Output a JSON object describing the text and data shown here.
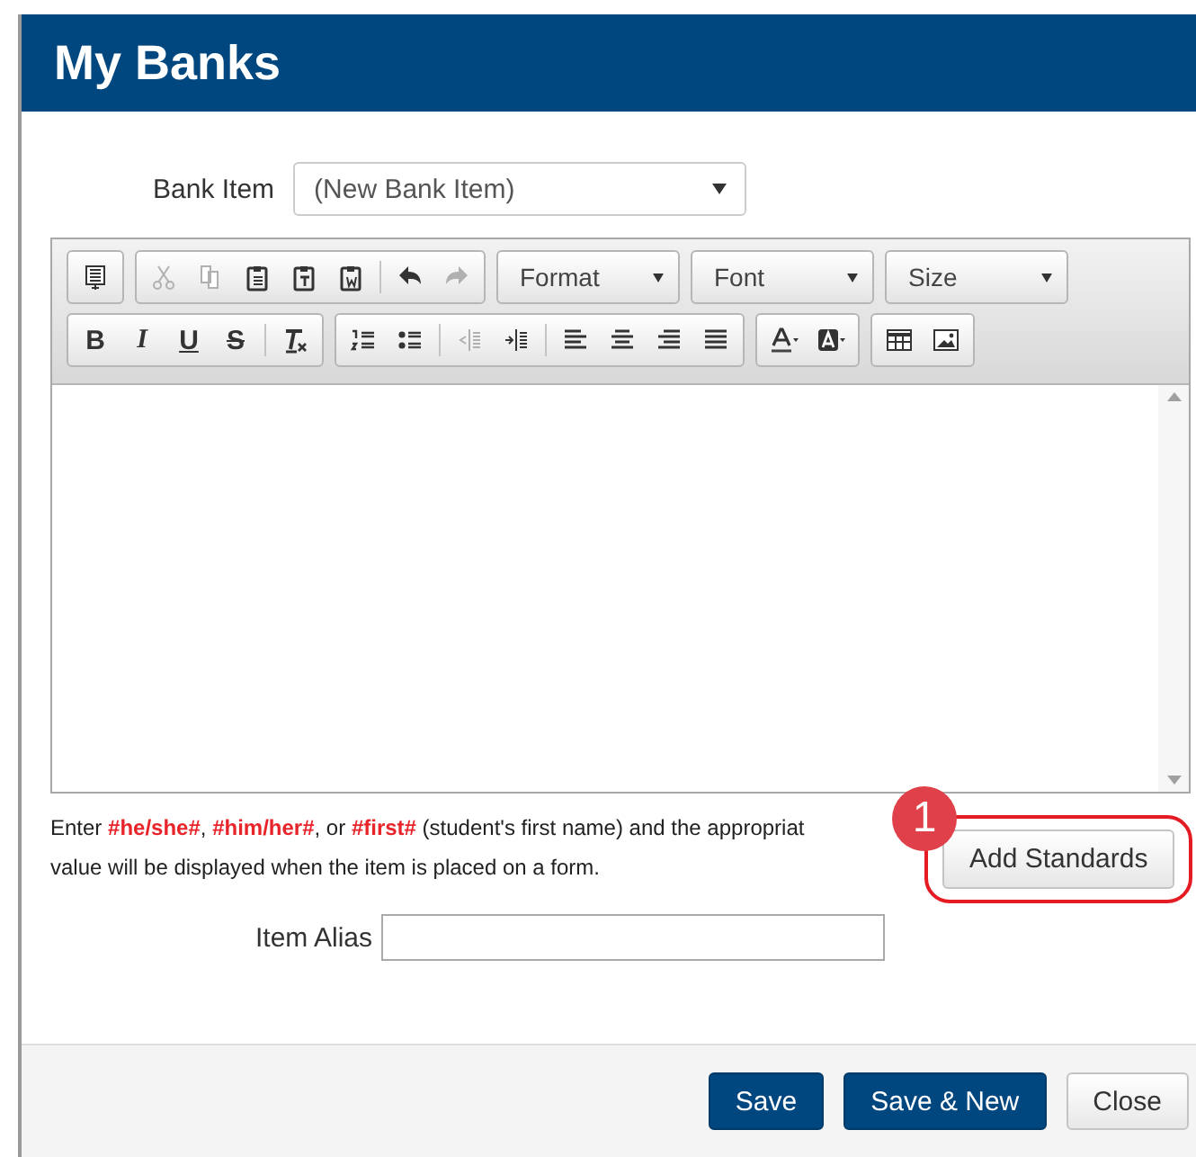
{
  "window": {
    "title": "My Banks"
  },
  "bank_item": {
    "label": "Bank Item",
    "value": "(New Bank Item)"
  },
  "toolbar": {
    "rows": [
      [
        {
          "items": [
            {
              "kind": "icon",
              "disabled": false
            }
          ]
        },
        {
          "items": [
            {
              "kind": "icon",
              "disabled": true
            },
            {
              "kind": "icon",
              "disabled": true
            },
            {
              "kind": "icon",
              "disabled": false
            },
            {
              "kind": "icon",
              "disabled": false
            },
            {
              "kind": "icon",
              "disabled": false
            },
            {
              "kind": "separator"
            },
            {
              "kind": "icon",
              "disabled": false
            },
            {
              "kind": "icon",
              "disabled": true
            }
          ]
        },
        {
          "items": [
            {
              "kind": "dropdown",
              "label": "Format"
            }
          ]
        },
        {
          "items": [
            {
              "kind": "dropdown",
              "label": "Font"
            }
          ]
        },
        {
          "items": [
            {
              "kind": "dropdown",
              "label": "Size"
            }
          ]
        }
      ],
      [
        {
          "items": [
            {
              "kind": "text",
              "label": "B",
              "disabled": false
            },
            {
              "kind": "text",
              "label": "I",
              "disabled": false
            },
            {
              "kind": "text",
              "label": "U",
              "disabled": false
            },
            {
              "kind": "text",
              "label": "S",
              "disabled": false
            },
            {
              "kind": "separator"
            },
            {
              "kind": "icon",
              "disabled": false
            }
          ]
        },
        {
          "items": [
            {
              "kind": "icon",
              "disabled": false
            },
            {
              "kind": "icon",
              "disabled": false
            },
            {
              "kind": "separator"
            },
            {
              "kind": "icon",
              "disabled": true
            },
            {
              "kind": "icon",
              "disabled": false
            },
            {
              "kind": "separator"
            },
            {
              "kind": "icon",
              "disabled": false
            },
            {
              "kind": "icon",
              "disabled": false
            },
            {
              "kind": "icon",
              "disabled": false
            },
            {
              "kind": "icon",
              "disabled": false
            }
          ]
        },
        {
          "items": [
            {
              "kind": "icon",
              "disabled": false
            },
            {
              "kind": "icon",
              "disabled": false
            }
          ]
        },
        {
          "items": [
            {
              "kind": "icon",
              "disabled": false
            },
            {
              "kind": "icon",
              "disabled": false
            }
          ]
        }
      ]
    ]
  },
  "hint": "Enter **#he/she#**, **#him/her#**, or **#first#** (student's first name) and the appropriat",
  "hint_line_2": "value will be displayed when the item is placed on a form.",
  "add_standards": {
    "label": "Add Standards",
    "badge": "1"
  },
  "item_alias": {
    "label": "Item Alias"
  },
  "buttons": [
    {
      "label": "Save",
      "kind": "primary"
    },
    {
      "label": "Save & New",
      "kind": "primary"
    },
    {
      "label": "Close",
      "kind": "default"
    }
  ]
}
